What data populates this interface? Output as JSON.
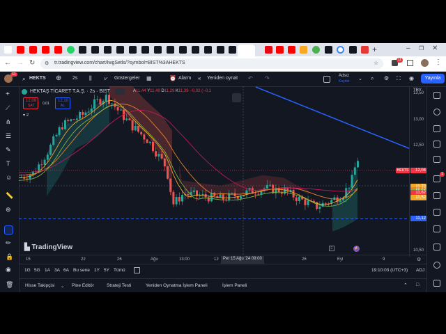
{
  "browser": {
    "url": "tr.tradingview.com/chart/IwgSetls/?symbol=BIST%3AHEKTS",
    "profile_badge": "11"
  },
  "header": {
    "symbol": "HEKTS",
    "interval": "2s",
    "indicators_label": "Göstergeler",
    "alarm_label": "Alarm",
    "replay_label": "Yeniden oynat",
    "layout_name": "Adsız",
    "layout_status": "Kaydet",
    "publish_label": "Yayınla"
  },
  "legend": {
    "title": "HEKTAŞ TİCARET T.A.Ş. · 2s · BIST",
    "o_label": "A",
    "o": "11,44",
    "h_label": "Y",
    "h": "11,49",
    "l_label": "D",
    "l": "11,29",
    "c_label": "K",
    "c": "11,39",
    "change": "−0,02 (−0,1",
    "sell_price": "12,09",
    "sell_label": "SAT",
    "spread": "0,01",
    "buy_price": "12,10",
    "buy_label": "AL",
    "indicator_count": "2"
  },
  "currency": "TRY",
  "watermark": "TradingView",
  "chart_data": {
    "type": "candlestick",
    "symbol": "HEKTS",
    "ylim": [
      10.5,
      13.7
    ],
    "y_ticks": [
      "13,50",
      "13,00",
      "12,50",
      "10,50"
    ],
    "x_ticks": [
      "15",
      "22",
      "26",
      "Ağu",
      "13:00",
      "12",
      "Per 15 Ağu '24  09:00",
      "26",
      "Eyl",
      "9"
    ],
    "price_labels": [
      {
        "label": "HEKTS",
        "value": "12,04",
        "color": "#f23645"
      },
      {
        "value": "11,74",
        "color": "#f5a623"
      },
      {
        "value": "11,72",
        "color": "#f5a623"
      },
      {
        "value": "11,67",
        "color": "#e8852c"
      },
      {
        "value": "11,64",
        "color": "#7cb342"
      },
      {
        "value": "11,62",
        "color": "#f23645"
      },
      {
        "value": "11,52",
        "color": "#f5a623"
      },
      {
        "value": "11,12",
        "color": "#2962ff"
      }
    ],
    "support_line": 11.12,
    "last_price": 12.04
  },
  "time_axis": {
    "clock": "19:10:03 (UTC+3)",
    "adj": "ADJ"
  },
  "ranges": [
    "1G",
    "5G",
    "1A",
    "3A",
    "6A",
    "Bu sene",
    "1Y",
    "5Y",
    "Tümü"
  ],
  "bottom_tabs": [
    "Hisse Takipçisi",
    "Pine Editör",
    "Strateji Testi",
    "Yeniden Oynatma İşlem Paneli",
    "İşlem Paneli"
  ],
  "colors": {
    "background": "#131722",
    "up": "#26a69a",
    "down": "#ef5350",
    "trend_line": "#2962ff",
    "accent": "#2962ff"
  }
}
